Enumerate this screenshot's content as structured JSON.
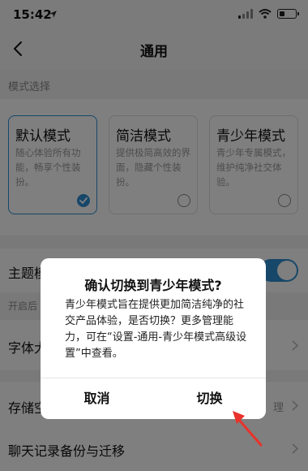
{
  "status_bar": {
    "time": "15:42"
  },
  "nav": {
    "title": "通用"
  },
  "mode_section": {
    "label": "模式选择",
    "cards": [
      {
        "title": "默认模式",
        "desc": "随心体验所有功能，畅享个性装扮。",
        "selected": true
      },
      {
        "title": "简洁模式",
        "desc": "提供极简高效的界面，隐藏个性装扮。",
        "selected": false
      },
      {
        "title": "青少年模式",
        "desc": "青少年专属模式，维护纯净社交体验。",
        "selected": false
      }
    ]
  },
  "settings": {
    "theme": {
      "label": "主题模",
      "sub": "开启后"
    },
    "font": {
      "label": "字体大"
    },
    "storage": {
      "label": "存储空",
      "extra": "理"
    },
    "chat_backup": {
      "label": "聊天记录备份与迁移"
    }
  },
  "dialog": {
    "title": "确认切换到青少年模式?",
    "body": "青少年模式旨在提供更加简洁纯净的社交产品体验，是否切换？更多管理能力，可在“设置-通用-青少年模式高级设置”中查看。",
    "cancel_label": "取消",
    "confirm_label": "切换"
  },
  "colors": {
    "accent": "#2e8fd3",
    "annotation_arrow": "#e8322b"
  },
  "icons": [
    "location-arrow-icon",
    "signal-icon",
    "wifi-icon",
    "battery-icon",
    "back-chevron-icon",
    "check-icon",
    "chevron-right-icon"
  ]
}
